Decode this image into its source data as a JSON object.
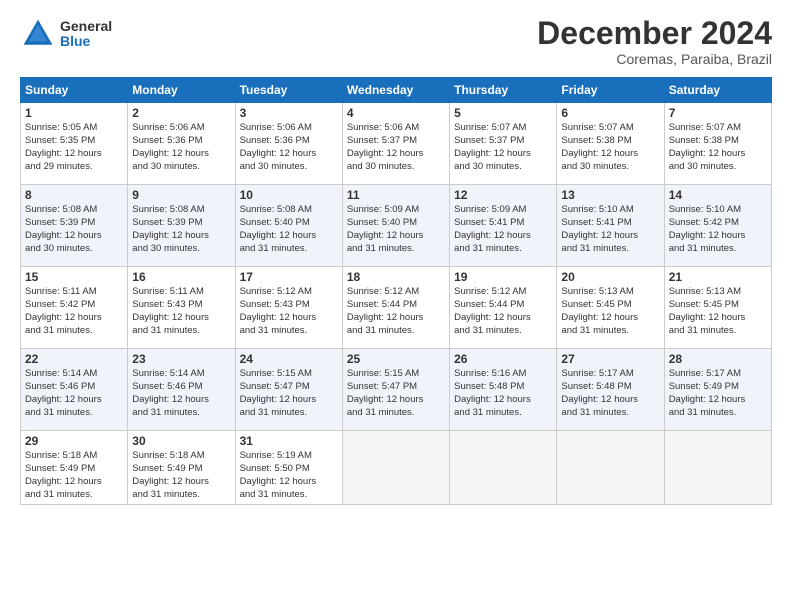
{
  "logo": {
    "general": "General",
    "blue": "Blue"
  },
  "header": {
    "month": "December 2024",
    "location": "Coremas, Paraiba, Brazil"
  },
  "weekdays": [
    "Sunday",
    "Monday",
    "Tuesday",
    "Wednesday",
    "Thursday",
    "Friday",
    "Saturday"
  ],
  "weeks": [
    [
      {
        "day": "1",
        "info": "Sunrise: 5:05 AM\nSunset: 5:35 PM\nDaylight: 12 hours\nand 29 minutes."
      },
      {
        "day": "2",
        "info": "Sunrise: 5:06 AM\nSunset: 5:36 PM\nDaylight: 12 hours\nand 30 minutes."
      },
      {
        "day": "3",
        "info": "Sunrise: 5:06 AM\nSunset: 5:36 PM\nDaylight: 12 hours\nand 30 minutes."
      },
      {
        "day": "4",
        "info": "Sunrise: 5:06 AM\nSunset: 5:37 PM\nDaylight: 12 hours\nand 30 minutes."
      },
      {
        "day": "5",
        "info": "Sunrise: 5:07 AM\nSunset: 5:37 PM\nDaylight: 12 hours\nand 30 minutes."
      },
      {
        "day": "6",
        "info": "Sunrise: 5:07 AM\nSunset: 5:38 PM\nDaylight: 12 hours\nand 30 minutes."
      },
      {
        "day": "7",
        "info": "Sunrise: 5:07 AM\nSunset: 5:38 PM\nDaylight: 12 hours\nand 30 minutes."
      }
    ],
    [
      {
        "day": "8",
        "info": "Sunrise: 5:08 AM\nSunset: 5:39 PM\nDaylight: 12 hours\nand 30 minutes."
      },
      {
        "day": "9",
        "info": "Sunrise: 5:08 AM\nSunset: 5:39 PM\nDaylight: 12 hours\nand 30 minutes."
      },
      {
        "day": "10",
        "info": "Sunrise: 5:08 AM\nSunset: 5:40 PM\nDaylight: 12 hours\nand 31 minutes."
      },
      {
        "day": "11",
        "info": "Sunrise: 5:09 AM\nSunset: 5:40 PM\nDaylight: 12 hours\nand 31 minutes."
      },
      {
        "day": "12",
        "info": "Sunrise: 5:09 AM\nSunset: 5:41 PM\nDaylight: 12 hours\nand 31 minutes."
      },
      {
        "day": "13",
        "info": "Sunrise: 5:10 AM\nSunset: 5:41 PM\nDaylight: 12 hours\nand 31 minutes."
      },
      {
        "day": "14",
        "info": "Sunrise: 5:10 AM\nSunset: 5:42 PM\nDaylight: 12 hours\nand 31 minutes."
      }
    ],
    [
      {
        "day": "15",
        "info": "Sunrise: 5:11 AM\nSunset: 5:42 PM\nDaylight: 12 hours\nand 31 minutes."
      },
      {
        "day": "16",
        "info": "Sunrise: 5:11 AM\nSunset: 5:43 PM\nDaylight: 12 hours\nand 31 minutes."
      },
      {
        "day": "17",
        "info": "Sunrise: 5:12 AM\nSunset: 5:43 PM\nDaylight: 12 hours\nand 31 minutes."
      },
      {
        "day": "18",
        "info": "Sunrise: 5:12 AM\nSunset: 5:44 PM\nDaylight: 12 hours\nand 31 minutes."
      },
      {
        "day": "19",
        "info": "Sunrise: 5:12 AM\nSunset: 5:44 PM\nDaylight: 12 hours\nand 31 minutes."
      },
      {
        "day": "20",
        "info": "Sunrise: 5:13 AM\nSunset: 5:45 PM\nDaylight: 12 hours\nand 31 minutes."
      },
      {
        "day": "21",
        "info": "Sunrise: 5:13 AM\nSunset: 5:45 PM\nDaylight: 12 hours\nand 31 minutes."
      }
    ],
    [
      {
        "day": "22",
        "info": "Sunrise: 5:14 AM\nSunset: 5:46 PM\nDaylight: 12 hours\nand 31 minutes."
      },
      {
        "day": "23",
        "info": "Sunrise: 5:14 AM\nSunset: 5:46 PM\nDaylight: 12 hours\nand 31 minutes."
      },
      {
        "day": "24",
        "info": "Sunrise: 5:15 AM\nSunset: 5:47 PM\nDaylight: 12 hours\nand 31 minutes."
      },
      {
        "day": "25",
        "info": "Sunrise: 5:15 AM\nSunset: 5:47 PM\nDaylight: 12 hours\nand 31 minutes."
      },
      {
        "day": "26",
        "info": "Sunrise: 5:16 AM\nSunset: 5:48 PM\nDaylight: 12 hours\nand 31 minutes."
      },
      {
        "day": "27",
        "info": "Sunrise: 5:17 AM\nSunset: 5:48 PM\nDaylight: 12 hours\nand 31 minutes."
      },
      {
        "day": "28",
        "info": "Sunrise: 5:17 AM\nSunset: 5:49 PM\nDaylight: 12 hours\nand 31 minutes."
      }
    ],
    [
      {
        "day": "29",
        "info": "Sunrise: 5:18 AM\nSunset: 5:49 PM\nDaylight: 12 hours\nand 31 minutes."
      },
      {
        "day": "30",
        "info": "Sunrise: 5:18 AM\nSunset: 5:49 PM\nDaylight: 12 hours\nand 31 minutes."
      },
      {
        "day": "31",
        "info": "Sunrise: 5:19 AM\nSunset: 5:50 PM\nDaylight: 12 hours\nand 31 minutes."
      },
      {
        "day": "",
        "info": ""
      },
      {
        "day": "",
        "info": ""
      },
      {
        "day": "",
        "info": ""
      },
      {
        "day": "",
        "info": ""
      }
    ]
  ]
}
